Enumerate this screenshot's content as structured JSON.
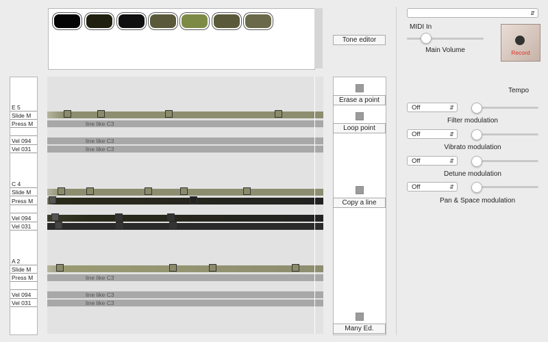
{
  "palette": {
    "swatches": [
      "#050505",
      "#202010",
      "#101010",
      "#5a5a3a",
      "#7d8a45",
      "#5a5a3a",
      "#6a6a4a"
    ]
  },
  "buttons": {
    "tone_editor": "Tone editor",
    "erase_point": "Erase a point",
    "loop_point": "Loop point",
    "copy_line": "Copy a line",
    "many_ed": "Many Ed."
  },
  "groups": [
    {
      "note": "E 5",
      "rows": [
        "Slide M",
        "Press M",
        "",
        "Vel 094",
        "Vel 031"
      ]
    },
    {
      "note": "C 4",
      "rows": [
        "Slide M",
        "Press M",
        "",
        "Vel 094",
        "Vel 031"
      ]
    },
    {
      "note": "A 2",
      "rows": [
        "Slide M",
        "Press M",
        "",
        "Vel 094",
        "Vel 031"
      ]
    }
  ],
  "track_labels": {
    "g0_press": "line like C3",
    "g0_vel094": "line like C3",
    "g0_vel031": "line like C3",
    "g2_press": "line like C3",
    "g2_vel094": "line like C3",
    "g2_vel031": "line like C3"
  },
  "right_panel": {
    "top_select": "",
    "midi_in": "MIDI In",
    "main_volume": "Main Volume",
    "record": "Record",
    "tempo": "Tempo",
    "modulations": [
      {
        "value": "Off",
        "label": "Filter modulation"
      },
      {
        "value": "Off",
        "label": "Vibrato modulation"
      },
      {
        "value": "Off",
        "label": "Detune modulation"
      },
      {
        "value": "Off",
        "label": "Pan & Space modulation"
      }
    ]
  }
}
